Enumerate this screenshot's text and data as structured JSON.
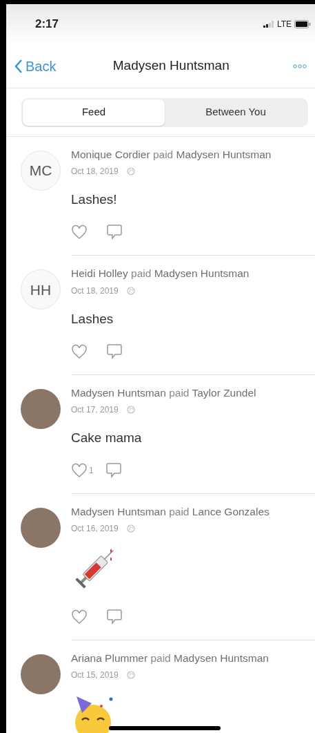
{
  "status_bar": {
    "time": "2:17",
    "network": "LTE"
  },
  "nav": {
    "back": "Back",
    "title": "Madysen Huntsman"
  },
  "tabs": [
    {
      "label": "Feed",
      "selected": true
    },
    {
      "label": "Between You",
      "selected": false
    }
  ],
  "posts": [
    {
      "avatar": {
        "kind": "initials",
        "initials": "MC"
      },
      "payer": "Monique Cordier",
      "verb": "paid",
      "payee": "Madysen Huntsman",
      "date": "Oct 18, 2019",
      "message": {
        "kind": "text",
        "text": "Lashes!"
      }
    },
    {
      "avatar": {
        "kind": "initials",
        "initials": "HH"
      },
      "payer": "Heidi Holley",
      "verb": "paid",
      "payee": "Madysen Huntsman",
      "date": "Oct 18, 2019",
      "message": {
        "kind": "text",
        "text": "Lashes"
      }
    },
    {
      "avatar": {
        "kind": "photo"
      },
      "payer": "Madysen Huntsman",
      "verb": "paid",
      "payee": "Taylor Zundel",
      "date": "Oct 17, 2019",
      "message": {
        "kind": "text",
        "text": "Cake mama"
      },
      "likes": "1"
    },
    {
      "avatar": {
        "kind": "photo"
      },
      "payer": "Madysen Huntsman",
      "verb": "paid",
      "payee": "Lance Gonzales",
      "date": "Oct 16, 2019",
      "message": {
        "kind": "syringe"
      }
    },
    {
      "avatar": {
        "kind": "photo"
      },
      "payer": "Ariana Plummer",
      "verb": "paid",
      "payee": "Madysen Huntsman",
      "date": "Oct 15, 2019",
      "message": {
        "kind": "party-face"
      }
    }
  ]
}
